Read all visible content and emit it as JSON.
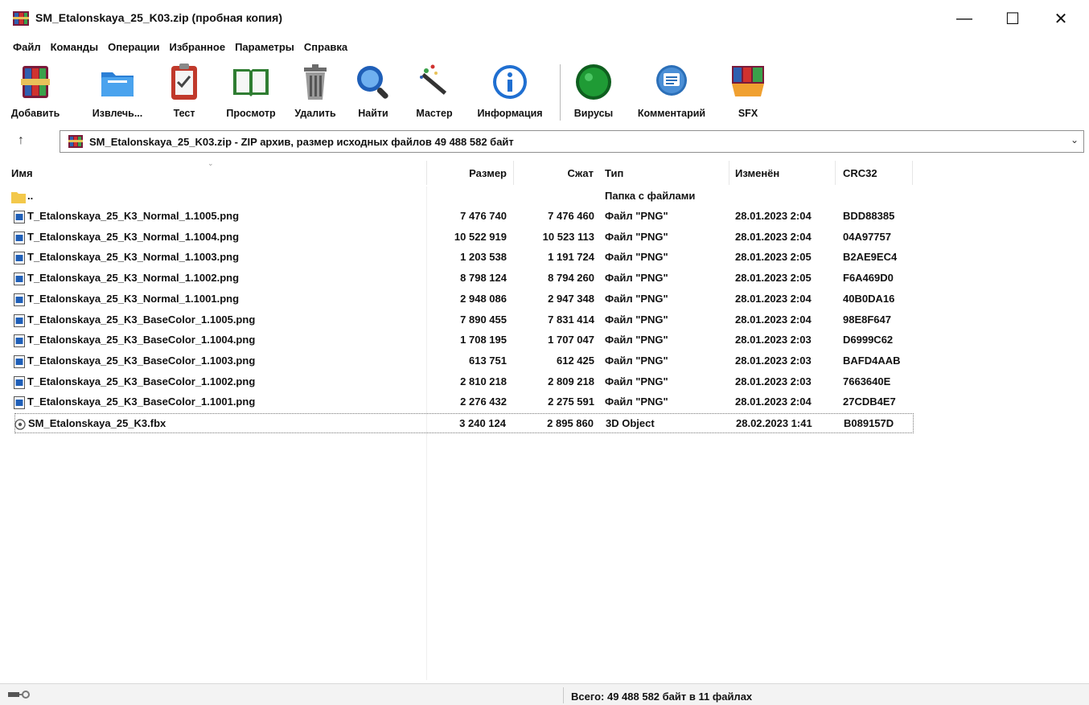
{
  "window": {
    "title": "SM_Etalonskaya_25_K03.zip (пробная копия)",
    "minimize_glyph": "—",
    "maximize_glyph": "☐",
    "close_glyph": "✕"
  },
  "menu": [
    "Файл",
    "Команды",
    "Операции",
    "Избранное",
    "Параметры",
    "Справка"
  ],
  "toolbar": [
    {
      "label": "Добавить",
      "icon": "add-archive-icon"
    },
    {
      "label": "Извлечь...",
      "icon": "extract-folder-icon"
    },
    {
      "label": "Тест",
      "icon": "test-clipboard-icon"
    },
    {
      "label": "Просмотр",
      "icon": "view-book-icon"
    },
    {
      "label": "Удалить",
      "icon": "delete-trash-icon"
    },
    {
      "label": "Найти",
      "icon": "find-magnifier-icon"
    },
    {
      "label": "Мастер",
      "icon": "wizard-wand-icon"
    },
    {
      "label": "Информация",
      "icon": "info-icon"
    },
    {
      "label": "Вирусы",
      "icon": "virus-scan-icon"
    },
    {
      "label": "Комментарий",
      "icon": "comment-icon"
    },
    {
      "label": "SFX",
      "icon": "sfx-archive-icon"
    }
  ],
  "address": {
    "up_glyph": "↑",
    "text": "SM_Etalonskaya_25_K03.zip - ZIP архив, размер исходных файлов 49 488 582 байт",
    "dropdown_glyph": "⌄"
  },
  "columns": {
    "name": "Имя",
    "size": "Размер",
    "packed": "Сжат",
    "type": "Тип",
    "modified": "Изменён",
    "crc": "CRC32"
  },
  "parent_row": {
    "name": "..",
    "type": "Папка с файлами"
  },
  "files": [
    {
      "name": "T_Etalonskaya_25_K3_Normal_1.1005.png",
      "size": "7 476 740",
      "packed": "7 476 460",
      "type": "Файл \"PNG\"",
      "modified": "28.01.2023 2:04",
      "crc": "BDD88385"
    },
    {
      "name": "T_Etalonskaya_25_K3_Normal_1.1004.png",
      "size": "10 522 919",
      "packed": "10 523 113",
      "type": "Файл \"PNG\"",
      "modified": "28.01.2023 2:04",
      "crc": "04A97757"
    },
    {
      "name": "T_Etalonskaya_25_K3_Normal_1.1003.png",
      "size": "1 203 538",
      "packed": "1 191 724",
      "type": "Файл \"PNG\"",
      "modified": "28.01.2023 2:05",
      "crc": "B2AE9EC4"
    },
    {
      "name": "T_Etalonskaya_25_K3_Normal_1.1002.png",
      "size": "8 798 124",
      "packed": "8 794 260",
      "type": "Файл \"PNG\"",
      "modified": "28.01.2023 2:05",
      "crc": "F6A469D0"
    },
    {
      "name": "T_Etalonskaya_25_K3_Normal_1.1001.png",
      "size": "2 948 086",
      "packed": "2 947 348",
      "type": "Файл \"PNG\"",
      "modified": "28.01.2023 2:04",
      "crc": "40B0DA16"
    },
    {
      "name": "T_Etalonskaya_25_K3_BaseColor_1.1005.png",
      "size": "7 890 455",
      "packed": "7 831 414",
      "type": "Файл \"PNG\"",
      "modified": "28.01.2023 2:04",
      "crc": "98E8F647"
    },
    {
      "name": "T_Etalonskaya_25_K3_BaseColor_1.1004.png",
      "size": "1 708 195",
      "packed": "1 707 047",
      "type": "Файл \"PNG\"",
      "modified": "28.01.2023 2:03",
      "crc": "D6999C62"
    },
    {
      "name": "T_Etalonskaya_25_K3_BaseColor_1.1003.png",
      "size": "613 751",
      "packed": "612 425",
      "type": "Файл \"PNG\"",
      "modified": "28.01.2023 2:03",
      "crc": "BAFD4AAB"
    },
    {
      "name": "T_Etalonskaya_25_K3_BaseColor_1.1002.png",
      "size": "2 810 218",
      "packed": "2 809 218",
      "type": "Файл \"PNG\"",
      "modified": "28.01.2023 2:03",
      "crc": "7663640E"
    },
    {
      "name": "T_Etalonskaya_25_K3_BaseColor_1.1001.png",
      "size": "2 276 432",
      "packed": "2 275 591",
      "type": "Файл \"PNG\"",
      "modified": "28.01.2023 2:04",
      "crc": "27CDB4E7"
    },
    {
      "name": "SM_Etalonskaya_25_K3.fbx",
      "size": "3 240 124",
      "packed": "2 895 860",
      "type": "3D Object",
      "modified": "28.02.2023 1:41",
      "crc": "B089157D"
    }
  ],
  "status": {
    "total": "Всего: 49 488 582 байт в 11 файлах",
    "left_icon": "drive-key-icon"
  },
  "colors": {
    "winrar_red": "#b3122a",
    "winrar_blue": "#1f4f9c",
    "folder_yellow": "#f3c84b",
    "virus_green": "#1f9b35",
    "info_blue": "#1f6fd1"
  }
}
